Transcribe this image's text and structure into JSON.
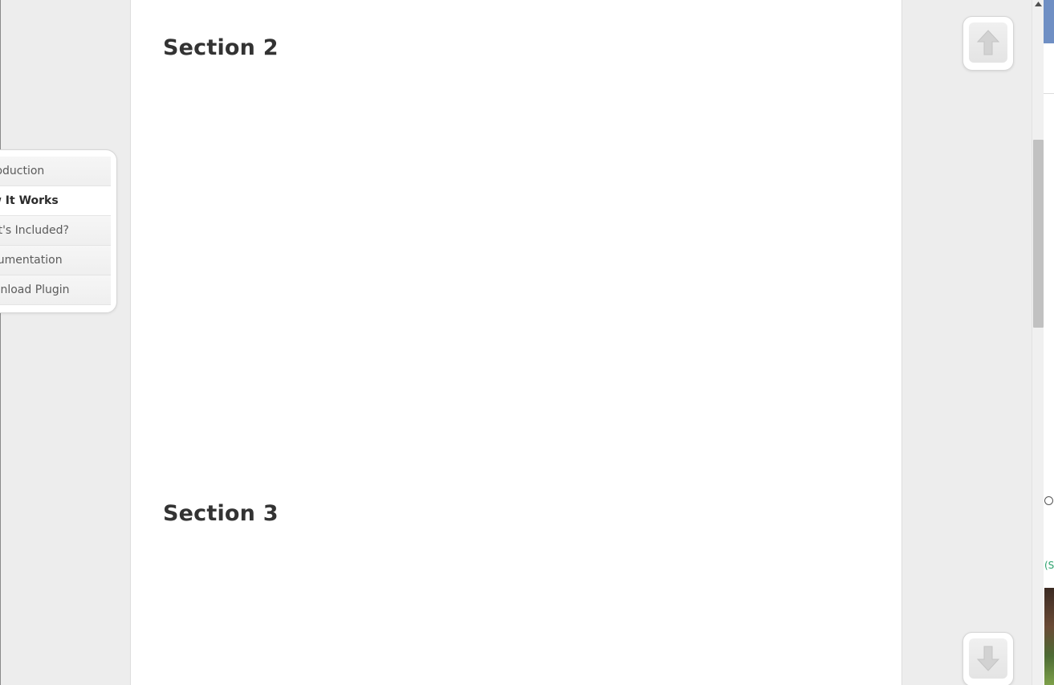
{
  "sections": [
    {
      "heading": "Section 2"
    },
    {
      "heading": "Section 3"
    }
  ],
  "side_nav": {
    "items": [
      {
        "label": "roduction",
        "active": false
      },
      {
        "label": "w It Works",
        "active": true
      },
      {
        "label": "at's Included?",
        "active": false
      },
      {
        "label": "cumentation",
        "active": false
      },
      {
        "label": "wnload Plugin",
        "active": false
      }
    ]
  },
  "controls": {
    "scroll_up_icon": "arrow-up-icon",
    "scroll_down_icon": "arrow-down-icon"
  },
  "right_strip": {
    "partial_text": "(S"
  },
  "colors": {
    "panel_bg": "#ffffff",
    "page_bg": "#ededed",
    "heading": "#333333",
    "nav_text": "#5b5b5b",
    "nav_active_text": "#2b2b2b"
  }
}
